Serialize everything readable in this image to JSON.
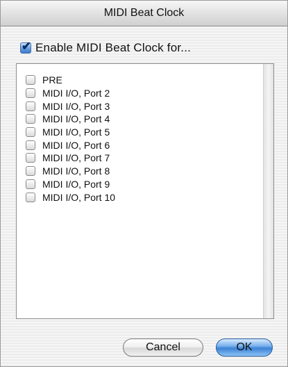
{
  "window": {
    "title": "MIDI Beat Clock"
  },
  "enable": {
    "label": "Enable MIDI Beat Clock for...",
    "checked": true
  },
  "ports": [
    {
      "label": "PRE",
      "checked": false
    },
    {
      "label": "MIDI I/O, Port 2",
      "checked": false
    },
    {
      "label": "MIDI I/O, Port 3",
      "checked": false
    },
    {
      "label": "MIDI I/O, Port 4",
      "checked": false
    },
    {
      "label": "MIDI I/O, Port 5",
      "checked": false
    },
    {
      "label": "MIDI I/O, Port 6",
      "checked": false
    },
    {
      "label": "MIDI I/O, Port 7",
      "checked": false
    },
    {
      "label": "MIDI I/O, Port 8",
      "checked": false
    },
    {
      "label": "MIDI I/O, Port 9",
      "checked": false
    },
    {
      "label": "MIDI I/O, Port 10",
      "checked": false
    }
  ],
  "buttons": {
    "cancel": "Cancel",
    "ok": "OK"
  },
  "icons": {
    "checkmark": "checkmark-icon"
  }
}
